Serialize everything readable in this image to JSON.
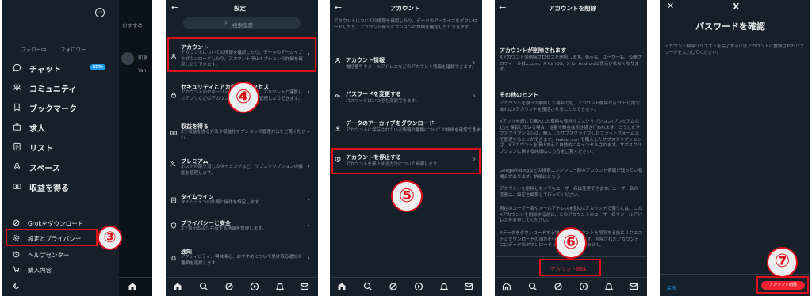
{
  "p1": {
    "tabs": [
      "フォロー中",
      "フォロワー"
    ],
    "menu": [
      "チャット",
      "コミュニティ",
      "ブックマーク",
      "求人",
      "リスト",
      "スペース",
      "収益を得る"
    ],
    "beta": "BETA",
    "bottom": [
      "Grokをダウンロード",
      "設定とプライバシー",
      "ヘルプセンター",
      "購入内容"
    ],
    "side_tab": "おすすめ",
    "side_texts": [
      "知恵",
      "Yah"
    ],
    "step": "③"
  },
  "p2": {
    "title": "設定",
    "search": "検索設定",
    "items": [
      {
        "title": "アカウント",
        "desc": "アカウントについての情報を確認したり、データのアーカイブをダウンロードしたり、アカウント停止オプションの詳細を確認したりできます。"
      },
      {
        "title": "セキュリティとアカウントアクセス",
        "desc": "アカウントのセキュリティを管理したり、アカウントと連携したアプリなどのアカウントによる使用を管理したりできます。"
      },
      {
        "title": "収益を得る",
        "desc": "Xで収益を得る方法や収益化オプションの管理方法をご覧ください。"
      },
      {
        "title": "プレミアム",
        "desc": "ポストの取り消しのタイミングなど、サブスクリプションの機能を管理します。"
      },
      {
        "title": "タイムライン",
        "desc": "タイムラインの外観と操作を設定します"
      },
      {
        "title": "プライバシーと安全",
        "desc": "Xで表示および共有する情報を管理します。"
      },
      {
        "title": "通知",
        "desc": "アクティビティ、興味関心、おすすめについて受け取る通知の種類を選択します。"
      }
    ],
    "step": "④"
  },
  "p3": {
    "title": "アカウント",
    "intro": "アカウントについての情報を確認したり、データのアーカイブをダウンロードしたり、アカウント停止オプションの詳細を確認したりできます。",
    "items": [
      {
        "title": "アカウント情報",
        "desc": "電話番号やメールアドレスなどのアカウント情報を確認できます。"
      },
      {
        "title": "パスワードを変更する",
        "desc": "パスワードはいつでも変更できます。"
      },
      {
        "title": "データのアーカイブをダウンロード",
        "desc": "アカウントに保存されている情報の種類についての詳細を確認できます。"
      },
      {
        "title": "アカウントを停止する",
        "desc": "アカウントを停止する方法について説明します"
      }
    ],
    "step": "⑤"
  },
  "p4": {
    "title": "アカウントを削除",
    "h1": "アカウントが削除されます",
    "p1": "Xアカウントの削除プロセスを開始します。表示名、ユーザー名、公開プロフィールはx.com、X for iOS、X for Androidに表示されなくなります。",
    "h2": "その他のヒント",
    "p2": "アカウントを誤って削除した場合でも、アカウント削除から30日以内であればXアカウントを復活させることができます。",
    "p3": "Xアプリを通じて購入した有料な有料サブスクリプション(プレミアムなど)を保有している場合、従量や課金は引き続き行われます。こうしたサブスクリプションは、購入したサブスクライブしたプラットフォーム上で管理することができます。twitter.comで購入したサブスクリプションは、Xアカウントを停止すると自動的にキャンセルされます。サブスクリプションに関する詳細はこちらをご覧ください。",
    "p4": "GoogleやBingなどの検索エンジンに一部のアカウント情報が残っている場合があります。詳細はこちら",
    "p5": "アカウントを削除しなくてもユーザー名は変更できます。ユーザー名の変更は、設定を編集して行ってください。",
    "p6": "現在のユーザー名やメールアドレスを別のXアカウントで使うには、このXアカウントを削除する前に、このアカウントのユーザー名やメールアドレスを変更してください。",
    "p7": "Xデータをダウンロードする場合は、アカウントを削除する前にリクエストとダウンロードの両方を行う必要があります。削除されたアカウントにはデータのダウンロードリンクを送信できません。",
    "button": "アカウント削除",
    "step": "⑥"
  },
  "p5": {
    "logo": "X",
    "title": "パスワードを確認",
    "desc": "アカウント削除リクエストを完了するにはアカウントに登録されたパスワードを入力してください。",
    "back": "戻る",
    "button": "アカウント削除",
    "step": "⑦"
  }
}
